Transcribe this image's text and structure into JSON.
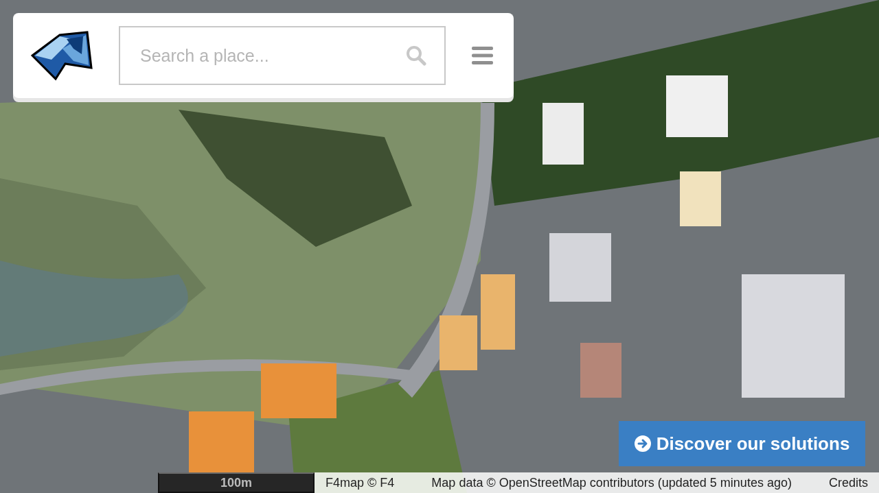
{
  "header": {
    "search": {
      "placeholder": "Search a place..."
    }
  },
  "cta_button": {
    "label": "Discover our solutions"
  },
  "scale_bar": {
    "label": "100m"
  },
  "attribution": {
    "items": [
      "F4map © F4",
      "Map data © OpenStreetMap contributors (updated 5 minutes ago)",
      "Credits"
    ]
  }
}
